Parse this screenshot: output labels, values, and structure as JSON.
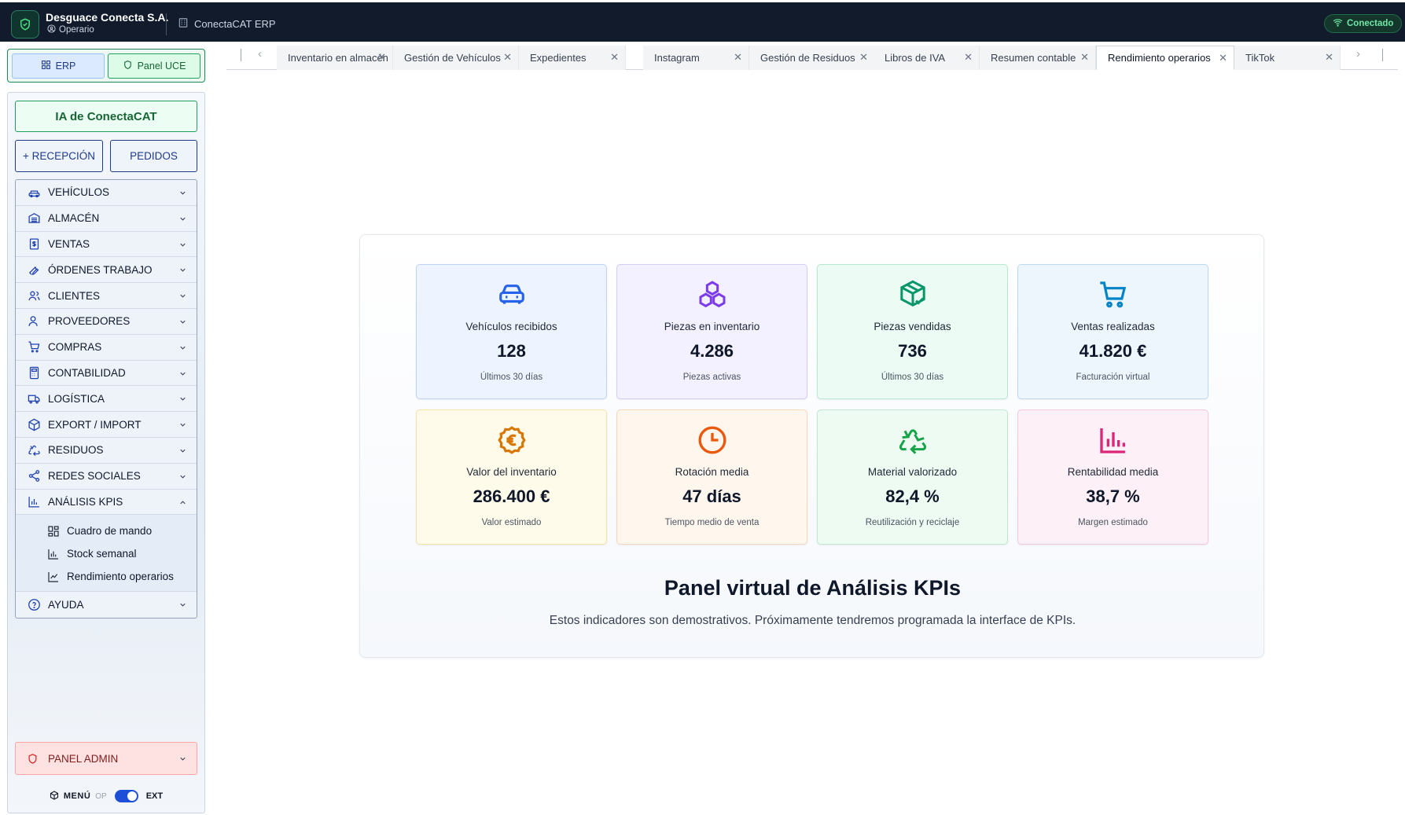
{
  "header": {
    "company": "Desguace Conecta S.A.",
    "role": "Operario",
    "app_name": "ConectaCAT ERP",
    "status": "Conectado"
  },
  "mode": {
    "erp_label": "ERP",
    "uce_label": "Panel UCE"
  },
  "sidebar": {
    "ia_label": "IA de ConectaCAT",
    "reception_label": "+ RECEPCIÓN",
    "orders_label": "PEDIDOS",
    "items": [
      {
        "label": "VEHÍCULOS",
        "icon": "car-icon"
      },
      {
        "label": "ALMACÉN",
        "icon": "warehouse-icon"
      },
      {
        "label": "VENTAS",
        "icon": "dollar-doc-icon"
      },
      {
        "label": "ÓRDENES TRABAJO",
        "icon": "wrench-icon"
      },
      {
        "label": "CLIENTES",
        "icon": "users-icon"
      },
      {
        "label": "PROVEEDORES",
        "icon": "user-group-icon"
      },
      {
        "label": "COMPRAS",
        "icon": "cart-icon"
      },
      {
        "label": "CONTABILIDAD",
        "icon": "calculator-icon"
      },
      {
        "label": "LOGÍSTICA",
        "icon": "truck-icon"
      },
      {
        "label": "EXPORT / IMPORT",
        "icon": "package-icon"
      },
      {
        "label": "RESIDUOS",
        "icon": "recycle-icon"
      },
      {
        "label": "REDES SOCIALES",
        "icon": "share-icon"
      },
      {
        "label": "ANÁLISIS KPIS",
        "icon": "bar-chart-icon",
        "expanded": true
      }
    ],
    "kpi_subitems": [
      {
        "label": "Cuadro de mando",
        "icon": "dashboard-icon"
      },
      {
        "label": "Stock semanal",
        "icon": "bar-chart-icon"
      },
      {
        "label": "Rendimiento operarios",
        "icon": "line-chart-icon"
      }
    ],
    "help_label": "AYUDA",
    "admin_label": "PANEL ADMIN",
    "menu_label": "MENÚ",
    "toggle_off": "OP",
    "toggle_on": "EXT"
  },
  "tabs": [
    {
      "label": "Inventario en almacén",
      "active": false
    },
    {
      "label": "Gestión de Vehículos",
      "active": false
    },
    {
      "label": "Expedientes",
      "active": false
    },
    {
      "label": "Instagram",
      "active": false
    },
    {
      "label": "Gestión de Residuos",
      "active": false
    },
    {
      "label": "Libros de IVA",
      "active": false
    },
    {
      "label": "Resumen contable",
      "active": false
    },
    {
      "label": "Rendimiento operarios",
      "active": true
    },
    {
      "label": "TikTok",
      "active": false
    }
  ],
  "kpis": [
    {
      "label": "Vehículos recibidos",
      "value": "128",
      "sub": "Últimos 30 días",
      "icon": "car-icon",
      "color": "#2563eb",
      "bg": "#eef4ff",
      "border": "#bfd3f5"
    },
    {
      "label": "Piezas en inventario",
      "value": "4.286",
      "sub": "Piezas activas",
      "icon": "boxes-icon",
      "color": "#7c3aed",
      "bg": "#f3f0ff",
      "border": "#d4ccf5"
    },
    {
      "label": "Piezas vendidas",
      "value": "736",
      "sub": "Últimos 30 días",
      "icon": "package-check-icon",
      "color": "#059669",
      "bg": "#ecfbf3",
      "border": "#b7e7cf"
    },
    {
      "label": "Ventas realizadas",
      "value": "41.820 €",
      "sub": "Facturación virtual",
      "icon": "cart-icon",
      "color": "#0284c7",
      "bg": "#eef6fd",
      "border": "#bcd9ef"
    },
    {
      "label": "Valor del inventario",
      "value": "286.400 €",
      "sub": "Valor estimado",
      "icon": "euro-icon",
      "color": "#d97706",
      "bg": "#fffbea",
      "border": "#f5e2a8"
    },
    {
      "label": "Rotación media",
      "value": "47 días",
      "sub": "Tiempo medio de venta",
      "icon": "clock-icon",
      "color": "#ea580c",
      "bg": "#fff6ee",
      "border": "#f7d6bb"
    },
    {
      "label": "Material valorizado",
      "value": "82,4 %",
      "sub": "Reutilización y reciclaje",
      "icon": "recycle-icon",
      "color": "#16a34a",
      "bg": "#eefbf2",
      "border": "#bfe8cc"
    },
    {
      "label": "Rentabilidad media",
      "value": "38,7 %",
      "sub": "Margen estimado",
      "icon": "bar-chart-icon",
      "color": "#db2777",
      "bg": "#fdf0f6",
      "border": "#f3c8dc"
    }
  ],
  "panel": {
    "title": "Panel virtual de Análisis KPIs",
    "description": "Estos indicadores son demostrativos. Próximamente tendremos programada la interface de KPIs."
  }
}
